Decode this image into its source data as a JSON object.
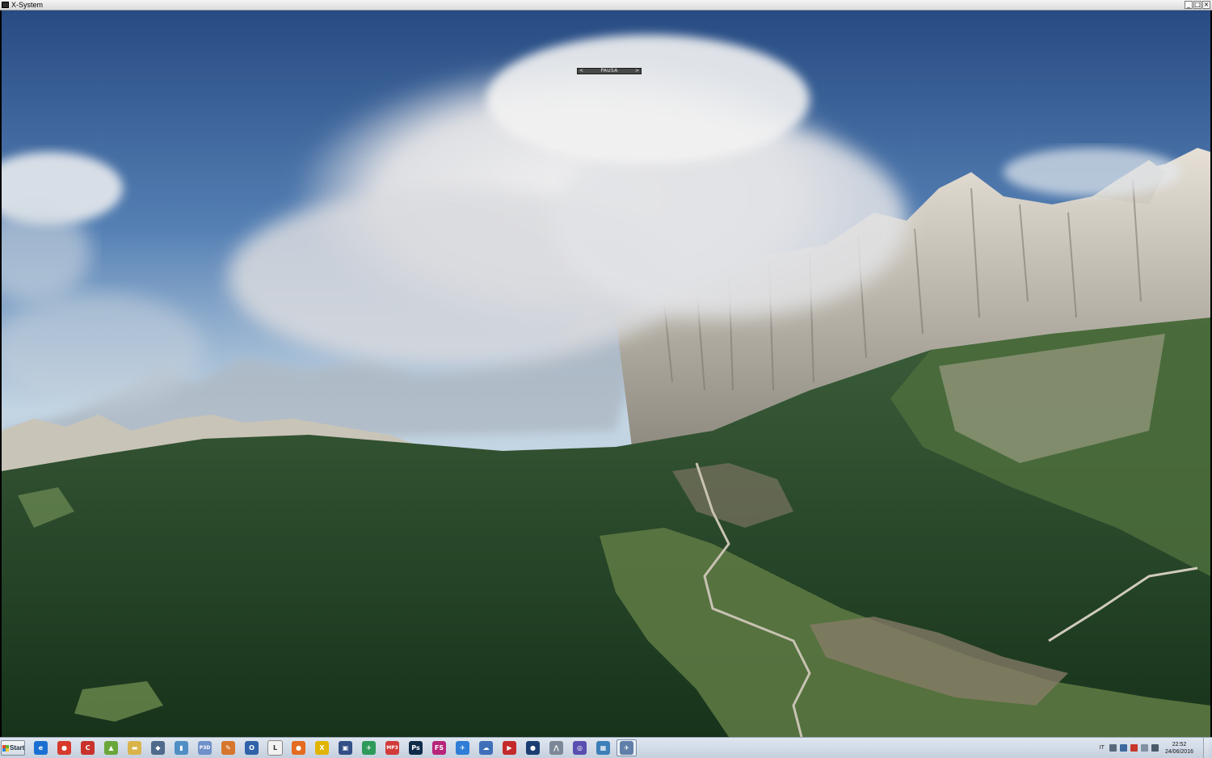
{
  "window": {
    "title": "X-System",
    "controls": {
      "minimize": "_",
      "maximize": "□",
      "close": "×"
    }
  },
  "sim": {
    "pause_label": "PAUSA",
    "pause_prev": "<",
    "pause_next": ">"
  },
  "taskbar": {
    "start_label": "Start",
    "icons": [
      {
        "name": "ie-icon",
        "glyph": "e",
        "color": "#1b6fd1"
      },
      {
        "name": "chrome-icon",
        "glyph": "●",
        "color": "#d8392b"
      },
      {
        "name": "ccleaner-icon",
        "glyph": "C",
        "color": "#c8322b"
      },
      {
        "name": "android-icon",
        "glyph": "▲",
        "color": "#6aa63a"
      },
      {
        "name": "folder-icon",
        "glyph": "▬",
        "color": "#d9b44a"
      },
      {
        "name": "network-icon",
        "glyph": "◆",
        "color": "#4f6a8a"
      },
      {
        "name": "app-blue-icon",
        "glyph": "▮",
        "color": "#4f8fc4"
      },
      {
        "name": "p3d-icon",
        "glyph": "P3D",
        "color": "#6f90c9"
      },
      {
        "name": "paint-icon",
        "glyph": "✎",
        "color": "#d6762c"
      },
      {
        "name": "outlook-icon",
        "glyph": "O",
        "color": "#2f62a8"
      },
      {
        "name": "document-icon",
        "glyph": "L",
        "color": "#f2f2f2"
      },
      {
        "name": "firefox-icon",
        "glyph": "●",
        "color": "#e46b1f"
      },
      {
        "name": "xplane-icon",
        "glyph": "X",
        "color": "#e0b400"
      },
      {
        "name": "monitor-icon",
        "glyph": "▣",
        "color": "#334f86"
      },
      {
        "name": "plane-green-icon",
        "glyph": "✈",
        "color": "#2d9a5a"
      },
      {
        "name": "mp3-icon",
        "glyph": "MP3",
        "color": "#d23a3a"
      },
      {
        "name": "photoshop-icon",
        "glyph": "Ps",
        "color": "#0f2b4a"
      },
      {
        "name": "fs-icon",
        "glyph": "FS",
        "color": "#b8247a"
      },
      {
        "name": "flight-icon",
        "glyph": "✈",
        "color": "#2f7dd6"
      },
      {
        "name": "cloud-app-icon",
        "glyph": "☁",
        "color": "#3f6fb8"
      },
      {
        "name": "media-icon",
        "glyph": "▶",
        "color": "#c42a2a"
      },
      {
        "name": "globe-icon",
        "glyph": "●",
        "color": "#1b3d72"
      },
      {
        "name": "network-tool-icon",
        "glyph": "⋀",
        "color": "#7c8898"
      },
      {
        "name": "browser-icon",
        "glyph": "◎",
        "color": "#5a4fb0"
      },
      {
        "name": "image-viewer-icon",
        "glyph": "▦",
        "color": "#3d7fb8"
      },
      {
        "name": "xsystem-icon",
        "glyph": "✈",
        "color": "#5f7fa8"
      }
    ],
    "tray": {
      "language": "IT",
      "time": "22:52",
      "date": "24/06/2016"
    }
  }
}
